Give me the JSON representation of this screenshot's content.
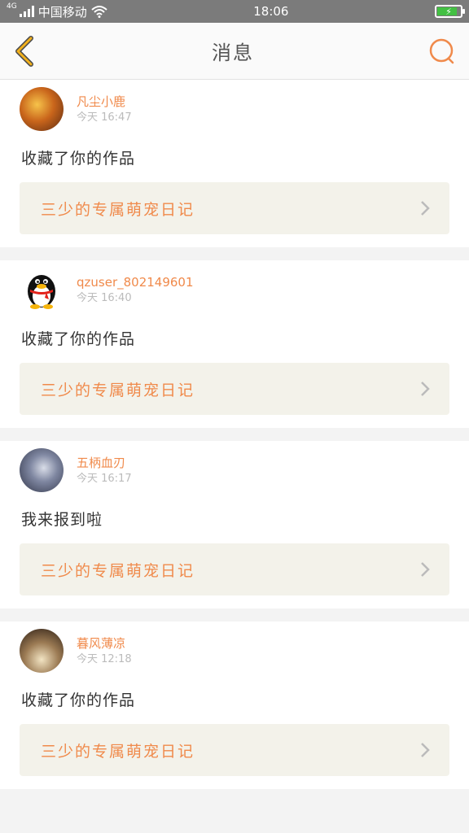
{
  "status_bar": {
    "network": "4G",
    "carrier": "中国移动",
    "time": "18:06"
  },
  "header": {
    "title": "消息"
  },
  "messages": [
    {
      "username": "凡尘小鹿",
      "time": "今天 16:47",
      "content": "收藏了你的作品",
      "work_title": "三少的专属萌宠日记"
    },
    {
      "username": "qzuser_802149601",
      "time": "今天 16:40",
      "content": "收藏了你的作品",
      "work_title": "三少的专属萌宠日记"
    },
    {
      "username": "五柄血刃",
      "time": "今天 16:17",
      "content": "我来报到啦",
      "work_title": "三少的专属萌宠日记"
    },
    {
      "username": "暮风薄凉",
      "time": "今天 12:18",
      "content": "收藏了你的作品",
      "work_title": "三少的专属萌宠日记"
    }
  ],
  "colors": {
    "accent": "#f08a4b",
    "back_icon": "#f2b11d",
    "status_bar": "#7b7b7b",
    "card_bg": "#f3f2ea"
  }
}
